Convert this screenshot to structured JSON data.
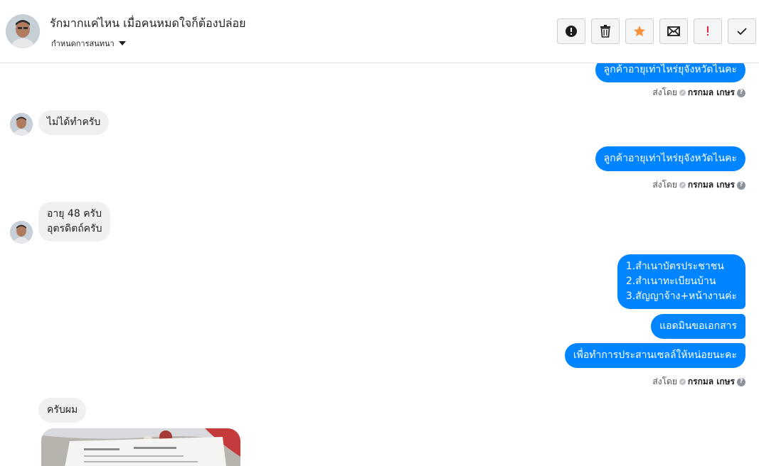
{
  "header": {
    "title": "รักมากแค่ไหน เมื่อคนหมดใจก็ต้องปล่อย",
    "subtitle": "กำหนดการสนทนา",
    "actions": [
      {
        "name": "report-icon"
      },
      {
        "name": "trash-icon"
      },
      {
        "name": "star-icon"
      },
      {
        "name": "envelope-icon"
      },
      {
        "name": "exclamation-icon"
      },
      {
        "name": "checkmark-icon"
      }
    ]
  },
  "messages": {
    "out_1": "ลูกค้าอายุเท่าไหร่ยุจังหวัดไนคะ",
    "out_2": "ลูกค้าอายุเท่าไหร่ยุจังหวัดไนคะ",
    "in_1": "ไม่ได้ทำครับ",
    "in_2_line1": "อายุ 48 ครับ",
    "in_2_line2": "อุตรดิตถ์ครับ",
    "out_3_line1": "1.สำเนาบัตรประชาชน",
    "out_3_line2": "2.สำเนาทะเบียนบ้าน",
    "out_3_line3": "3.สัญญาจ้าง+หน้างานค่ะ",
    "out_4": "แอดมินขอเอกสาร",
    "out_5": "เพื่อทำการประสานเซลล์ให้หน่อยนะคะ",
    "in_3": "ครับผม"
  },
  "sent_by": {
    "prefix": "ส่งโดย",
    "sender": "กรกมล เกษร",
    "help": "?"
  },
  "colors": {
    "accent": "#0084ff",
    "incoming_bubble": "#f1f0f0",
    "star": "#f7923b",
    "alert": "#e41e3f"
  }
}
